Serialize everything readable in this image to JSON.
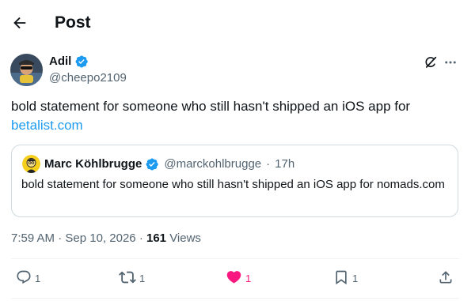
{
  "header": {
    "title": "Post"
  },
  "author": {
    "name": "Adil",
    "handle": "@cheepo2109",
    "verified": true
  },
  "tweet": {
    "text": "bold statement for someone who still hasn't shipped an iOS app for",
    "link_text": "betalist.com"
  },
  "quote": {
    "name": "Marc Köhlbrugge",
    "handle": "@marckohlbrugge",
    "separator": "·",
    "time": "17h",
    "text": "bold statement for someone who still hasn't shipped an iOS app for nomads.com"
  },
  "meta": {
    "time": "7:59 AM",
    "separator1": "·",
    "date": "Sep 10, 2026",
    "separator2": "·",
    "views_count": "161",
    "views_label": "Views"
  },
  "actions": {
    "replies": "1",
    "reposts": "1",
    "likes": "1",
    "bookmarks": "1"
  },
  "colors": {
    "accent": "#1d9bf0",
    "like": "#f91880",
    "muted": "#536471"
  }
}
